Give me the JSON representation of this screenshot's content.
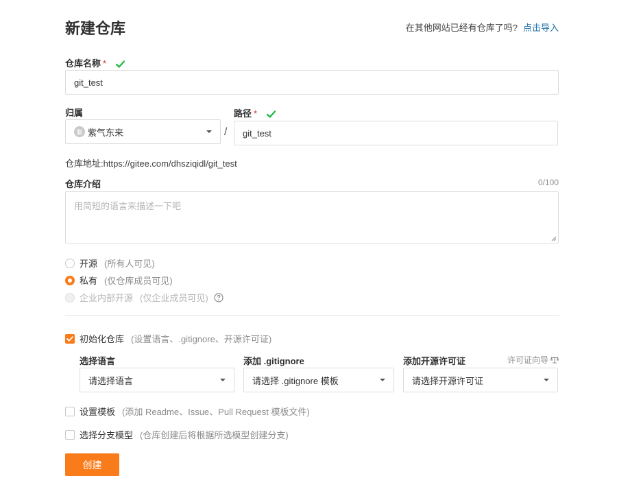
{
  "page": {
    "title": "新建仓库"
  },
  "import": {
    "prompt": "在其他网站已经有仓库了吗?",
    "link": "点击导入"
  },
  "repo_name": {
    "label": "仓库名称",
    "required": "*",
    "value": "git_test"
  },
  "owner": {
    "label": "归属",
    "avatar_char": "紫",
    "value": "紫气东来"
  },
  "separator": "/",
  "path": {
    "label": "路径",
    "required": "*",
    "value": "git_test"
  },
  "repo_address": {
    "text": "仓库地址:https://gitee.com/dhsziqidl/git_test"
  },
  "description": {
    "label": "仓库介绍",
    "counter": "0/100",
    "placeholder": "用简短的语言来描述一下吧"
  },
  "visibility": {
    "public": {
      "label": "开源",
      "hint": "(所有人可见)",
      "selected": false
    },
    "private": {
      "label": "私有",
      "hint": "(仅仓库成员可见)",
      "selected": true
    },
    "enterprise": {
      "label": "企业内部开源",
      "hint": "(仅企业成员可见)",
      "disabled": true
    }
  },
  "init_repo": {
    "label": "初始化仓库",
    "hint": "(设置语言、.gitignore、开源许可证)",
    "checked": true
  },
  "language": {
    "label": "选择语言",
    "value": "请选择语言"
  },
  "gitignore": {
    "label": "添加 .gitignore",
    "value": "请选择 .gitignore 模板"
  },
  "license": {
    "label": "添加开源许可证",
    "guide": "许可证向导",
    "value": "请选择开源许可证"
  },
  "template": {
    "label": "设置模板",
    "hint": "(添加 Readme、Issue、Pull Request 模板文件)",
    "checked": false
  },
  "branch_model": {
    "label": "选择分支模型",
    "hint": "(仓库创建后将根据所选模型创建分支)",
    "checked": false
  },
  "submit": {
    "label": "创建"
  },
  "colors": {
    "accent": "#fa7b1a",
    "success": "#21ba45",
    "required": "#db2828",
    "link": "#1c6fa8"
  }
}
